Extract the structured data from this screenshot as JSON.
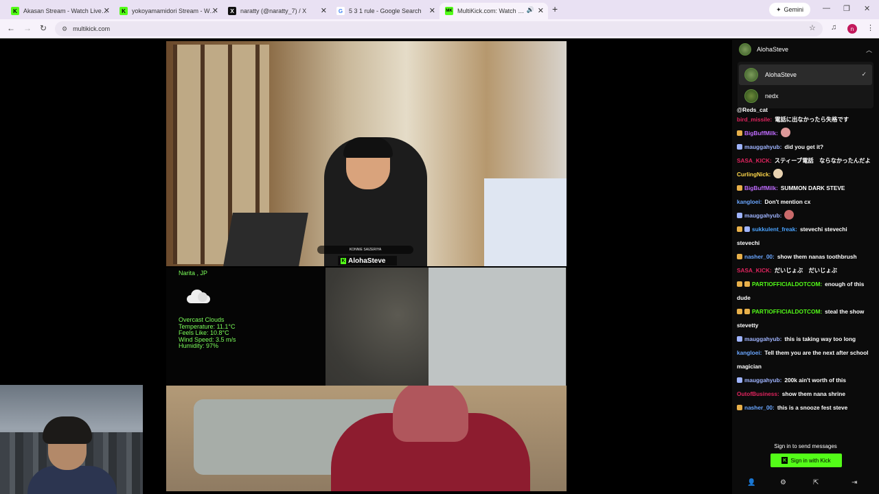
{
  "browser": {
    "tabs": [
      {
        "title": "Akasan Stream - Watch Live on",
        "favicon": "K",
        "favicon_color": "#53fc18"
      },
      {
        "title": "yokoyamamidori Stream - Watc",
        "favicon": "K",
        "favicon_color": "#53fc18"
      },
      {
        "title": "naratty (@naratty_7) / X",
        "favicon": "X",
        "favicon_color": "#111111"
      },
      {
        "title": "5 3 1 rule - Google Search",
        "favicon": "G",
        "favicon_color": "#ffffff"
      },
      {
        "title": "MultiKick.com: Watch Multi",
        "favicon": "MK",
        "favicon_color": "#53fc18"
      }
    ],
    "gemini_label": "Gemini",
    "url": "multikick.com",
    "profile_initial": "n"
  },
  "streams": {
    "main_name": "AlohaSteve",
    "small_badge": "KONNIE SAIZERIYA",
    "weather": {
      "location": "Narita , JP",
      "lines": [
        "Overcast Clouds",
        "Temperature: 11.1°C",
        "Feels Like: 10.8°C",
        "Wind Speed: 3.5 m/s",
        "Humidity: 97%"
      ]
    }
  },
  "chat": {
    "channel": "AlohaSteve",
    "dropdown": [
      {
        "name": "AlohaSteve",
        "selected": true
      },
      {
        "name": "nedx",
        "selected": false
      }
    ],
    "messages": [
      {
        "user": "",
        "text": "@Reds_cat",
        "color": "#ffffff"
      },
      {
        "user": "bird_missile",
        "text": "電話に出なかったら失格です",
        "color": "#e0245e"
      },
      {
        "user": "BigBuffMilk",
        "text": "",
        "color": "#c06cff",
        "emote": true
      },
      {
        "user": "mauggahyub",
        "text": "did you get it?",
        "color": "#9fb4ff"
      },
      {
        "user": "SASA_KICK",
        "text": "スティーブ電話　ならなかったんだよ",
        "color": "#e0245e"
      },
      {
        "user": "CurlingNick",
        "text": "",
        "color": "#ffd84a",
        "emote": true
      },
      {
        "user": "BigBuffMilk",
        "text": "SUMMON DARK STEVE",
        "color": "#c06cff"
      },
      {
        "user": "kangloei",
        "text": "Don't mention cx",
        "color": "#6aa6ff"
      },
      {
        "user": "mauggahyub",
        "text": "",
        "color": "#9fb4ff",
        "emote": true
      },
      {
        "user": "sukkulent_freak",
        "text": "stevechi stevechi stevechi",
        "color": "#4aa3ff"
      },
      {
        "user": "nasher_00",
        "text": "show them nanas toothbrush",
        "color": "#6aa6ff"
      },
      {
        "user": "SASA_KICK",
        "text": "だいじょぶ　だいじょぶ",
        "color": "#e0245e"
      },
      {
        "user": "PARTIOFFICIALDOTCOM",
        "text": "enough of this dude",
        "color": "#53fc18"
      },
      {
        "user": "PARTIOFFICIALDOTCOM",
        "text": "steal the show stevetty",
        "color": "#53fc18"
      },
      {
        "user": "mauggahyub",
        "text": "this is taking way too long",
        "color": "#9fb4ff"
      },
      {
        "user": "kangloei",
        "text": "Tell them you are the next after school magician",
        "color": "#6aa6ff"
      },
      {
        "user": "mauggahyub",
        "text": "200k ain't worth of this",
        "color": "#9fb4ff"
      },
      {
        "user": "OutofBusiness",
        "text": "show them nana shrine",
        "color": "#e0245e"
      },
      {
        "user": "nasher_00",
        "text": "this is a snooze fest steve",
        "color": "#6aa6ff"
      }
    ],
    "signin_prompt": "Sign in to send messages",
    "signin_button": "Sign in with Kick"
  }
}
